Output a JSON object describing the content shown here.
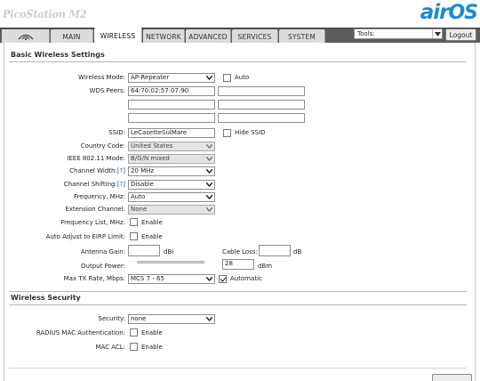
{
  "header": {
    "brand": "PicoStation M2",
    "logo_air": "air",
    "logo_os": "OS"
  },
  "tabs": [
    {
      "label": "MAIN"
    },
    {
      "label": "WIRELESS",
      "active": true
    },
    {
      "label": "NETWORK"
    },
    {
      "label": "ADVANCED"
    },
    {
      "label": "SERVICES"
    },
    {
      "label": "SYSTEM"
    }
  ],
  "tools": {
    "selected": "Tools:"
  },
  "logout_label": "Logout",
  "basic": {
    "title": "Basic Wireless Settings",
    "wireless_mode": {
      "label": "Wireless Mode:",
      "value": "AP-Repeater",
      "auto_label": "Auto",
      "auto_checked": false
    },
    "wds": {
      "label": "WDS Peers:",
      "peers": [
        "64:70:02:57:07:90",
        "",
        "",
        "",
        "",
        ""
      ]
    },
    "ssid": {
      "label": "SSID:",
      "value": "LeCasetteSulMare",
      "hide_label": "Hide SSID",
      "hide_checked": false
    },
    "country": {
      "label": "Country Code:",
      "value": "United States"
    },
    "ieee": {
      "label": "IEEE 802.11 Mode:",
      "value": "B/G/N mixed"
    },
    "width": {
      "label": "Channel Width:",
      "help": "[?]",
      "value": "20 MHz"
    },
    "shifting": {
      "label": "Channel Shifting:",
      "help": "[?]",
      "value": "Disable"
    },
    "frequency": {
      "label": "Frequency, MHz:",
      "value": "Auto"
    },
    "extension": {
      "label": "Extension Channel:",
      "value": "None"
    },
    "freq_list": {
      "label": "Frequency List, MHz:",
      "enable_label": "Enable",
      "checked": false
    },
    "eirp": {
      "label": "Auto Adjust to EIRP Limit:",
      "enable_label": "Enable",
      "checked": false
    },
    "antenna": {
      "label": "Antenna Gain:",
      "value": "",
      "unit": "dBi"
    },
    "cable": {
      "label": "Cable Loss:",
      "value": "",
      "unit": "dB"
    },
    "power": {
      "label": "Output Power:",
      "value": "28",
      "unit": "dBm"
    },
    "txrate": {
      "label": "Max TX Rate, Mbps:",
      "value": "MCS 7 - 65",
      "auto_label": "Automatic",
      "auto_checked": true
    }
  },
  "security": {
    "title": "Wireless Security",
    "security": {
      "label": "Security:",
      "value": "none"
    },
    "radius": {
      "label": "RADIUS MAC Authentication:",
      "enable_label": "Enable",
      "checked": false
    },
    "macacl": {
      "label": "MAC ACL:",
      "enable_label": "Enable",
      "checked": false
    }
  }
}
